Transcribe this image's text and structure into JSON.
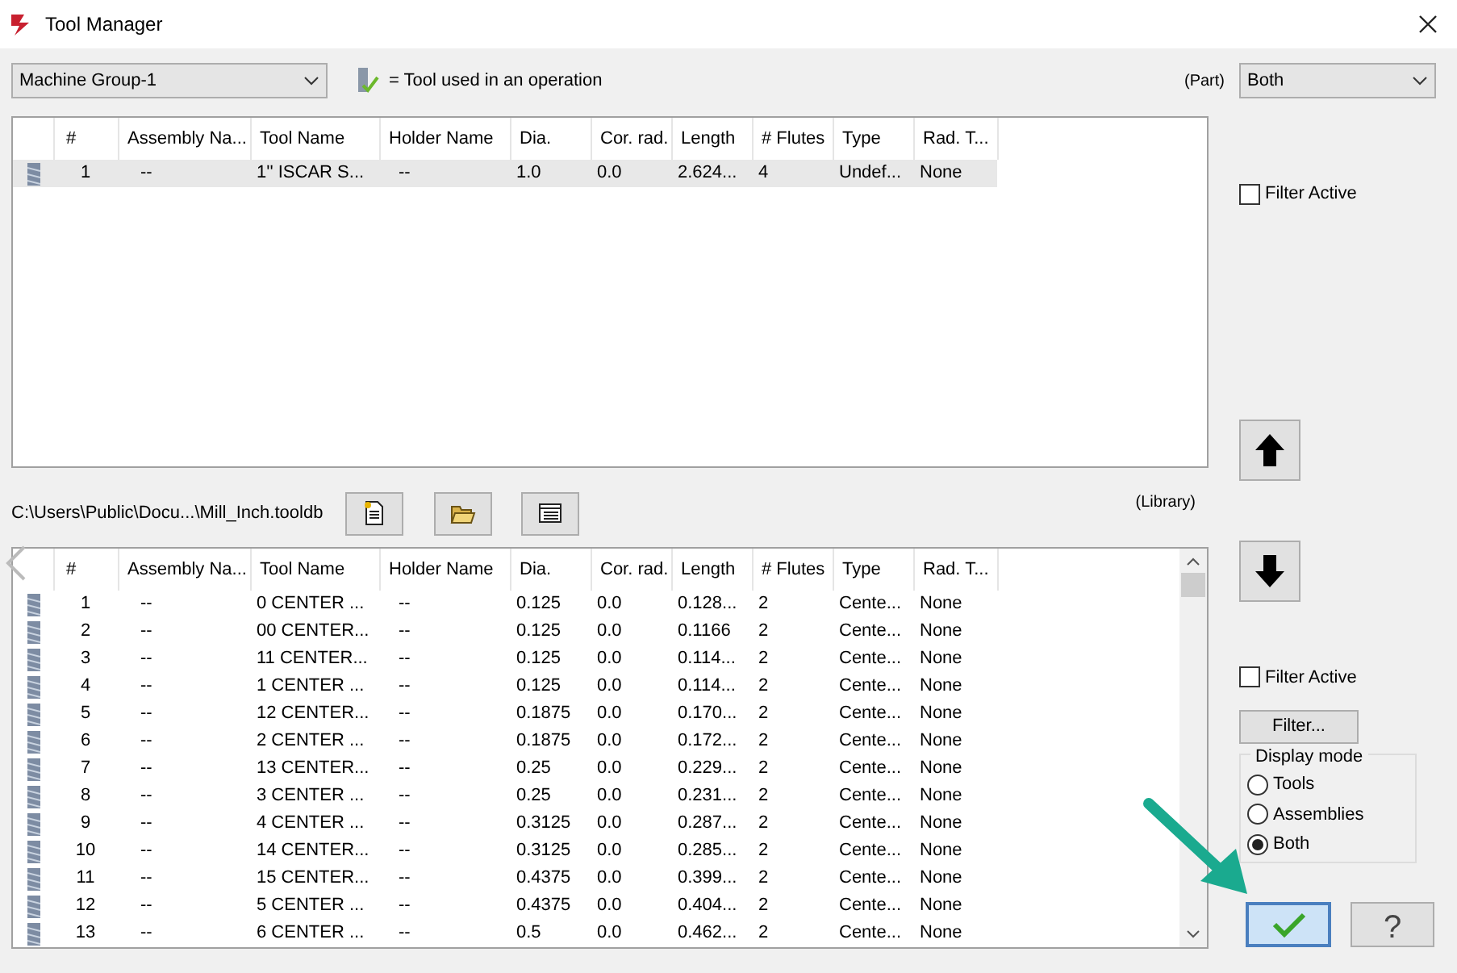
{
  "window": {
    "title": "Tool Manager"
  },
  "machine_group": {
    "value": "Machine Group-1"
  },
  "legend": {
    "text": "= Tool used in an operation"
  },
  "part_filter": {
    "label": "(Part)",
    "value": "Both"
  },
  "part_table": {
    "columns": [
      "#",
      "Assembly Na...",
      "Tool Name",
      "Holder Name",
      "Dia.",
      "Cor. rad.",
      "Length",
      "# Flutes",
      "Type",
      "Rad. T..."
    ],
    "rows": [
      {
        "selected": true,
        "cells": [
          "1",
          "--",
          "1'' ISCAR S...",
          "--",
          "1.0",
          "0.0",
          "2.624...",
          "4",
          "Undef...",
          "None"
        ]
      }
    ]
  },
  "part_filter_active": {
    "label": "Filter Active",
    "checked": false
  },
  "library": {
    "path": "C:\\Users\\Public\\Docu...\\Mill_Inch.tooldb",
    "label": "(Library)"
  },
  "library_table": {
    "columns": [
      "#",
      "Assembly Na...",
      "Tool Name",
      "Holder Name",
      "Dia.",
      "Cor. rad.",
      "Length",
      "# Flutes",
      "Type",
      "Rad. T..."
    ],
    "rows": [
      {
        "selected": false,
        "cells": [
          "1",
          "--",
          "0 CENTER ...",
          "--",
          "0.125",
          "0.0",
          "0.128...",
          "2",
          "Cente...",
          "None"
        ]
      },
      {
        "selected": false,
        "cells": [
          "2",
          "--",
          "00 CENTER...",
          "--",
          "0.125",
          "0.0",
          "0.1166",
          "2",
          "Cente...",
          "None"
        ]
      },
      {
        "selected": false,
        "cells": [
          "3",
          "--",
          "11 CENTER...",
          "--",
          "0.125",
          "0.0",
          "0.114...",
          "2",
          "Cente...",
          "None"
        ]
      },
      {
        "selected": false,
        "cells": [
          "4",
          "--",
          "1 CENTER ...",
          "--",
          "0.125",
          "0.0",
          "0.114...",
          "2",
          "Cente...",
          "None"
        ]
      },
      {
        "selected": false,
        "cells": [
          "5",
          "--",
          "12 CENTER...",
          "--",
          "0.1875",
          "0.0",
          "0.170...",
          "2",
          "Cente...",
          "None"
        ]
      },
      {
        "selected": false,
        "cells": [
          "6",
          "--",
          "2 CENTER ...",
          "--",
          "0.1875",
          "0.0",
          "0.172...",
          "2",
          "Cente...",
          "None"
        ]
      },
      {
        "selected": false,
        "cells": [
          "7",
          "--",
          "13 CENTER...",
          "--",
          "0.25",
          "0.0",
          "0.229...",
          "2",
          "Cente...",
          "None"
        ]
      },
      {
        "selected": false,
        "cells": [
          "8",
          "--",
          "3 CENTER ...",
          "--",
          "0.25",
          "0.0",
          "0.231...",
          "2",
          "Cente...",
          "None"
        ]
      },
      {
        "selected": false,
        "cells": [
          "9",
          "--",
          "4 CENTER ...",
          "--",
          "0.3125",
          "0.0",
          "0.287...",
          "2",
          "Cente...",
          "None"
        ]
      },
      {
        "selected": false,
        "cells": [
          "10",
          "--",
          "14 CENTER...",
          "--",
          "0.3125",
          "0.0",
          "0.285...",
          "2",
          "Cente...",
          "None"
        ]
      },
      {
        "selected": false,
        "cells": [
          "11",
          "--",
          "15 CENTER...",
          "--",
          "0.4375",
          "0.0",
          "0.399...",
          "2",
          "Cente...",
          "None"
        ]
      },
      {
        "selected": false,
        "cells": [
          "12",
          "--",
          "5 CENTER ...",
          "--",
          "0.4375",
          "0.0",
          "0.404...",
          "2",
          "Cente...",
          "None"
        ]
      },
      {
        "selected": false,
        "cells": [
          "13",
          "--",
          "6 CENTER ...",
          "--",
          "0.5",
          "0.0",
          "0.462...",
          "2",
          "Cente...",
          "None"
        ]
      }
    ]
  },
  "library_filter_active": {
    "label": "Filter Active",
    "checked": false
  },
  "filter_button": {
    "label": "Filter..."
  },
  "display_mode": {
    "title": "Display mode",
    "options": [
      {
        "label": "Tools",
        "selected": false
      },
      {
        "label": "Assemblies",
        "selected": false
      },
      {
        "label": "Both",
        "selected": true
      }
    ]
  },
  "help_button": {
    "label": "?"
  }
}
